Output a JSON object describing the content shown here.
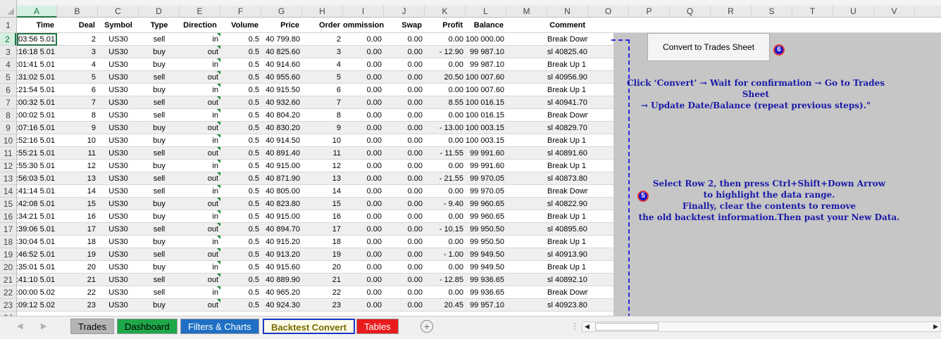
{
  "columns": [
    {
      "letter": "A",
      "header": "Time"
    },
    {
      "letter": "B",
      "header": "Deal"
    },
    {
      "letter": "C",
      "header": "Symbol"
    },
    {
      "letter": "D",
      "header": "Type"
    },
    {
      "letter": "E",
      "header": "Direction"
    },
    {
      "letter": "F",
      "header": "Volume"
    },
    {
      "letter": "G",
      "header": "Price"
    },
    {
      "letter": "H",
      "header": "Order"
    },
    {
      "letter": "I",
      "header": "ommission"
    },
    {
      "letter": "J",
      "header": "Swap"
    },
    {
      "letter": "K",
      "header": "Profit"
    },
    {
      "letter": "L",
      "header": "Balance"
    },
    {
      "letter": "M",
      "header": ""
    },
    {
      "letter": "N",
      "header": "Comment"
    },
    {
      "letter": "O",
      "header": ""
    },
    {
      "letter": "P",
      "header": ""
    },
    {
      "letter": "Q",
      "header": ""
    },
    {
      "letter": "R",
      "header": ""
    },
    {
      "letter": "S",
      "header": ""
    },
    {
      "letter": "T",
      "header": ""
    },
    {
      "letter": "U",
      "header": ""
    },
    {
      "letter": "V",
      "header": ""
    }
  ],
  "row_numbers": [
    "1",
    "2",
    "3",
    "4",
    "5",
    "6",
    "7",
    "8",
    "9",
    "10",
    "11",
    "12",
    "13",
    "14",
    "15",
    "16",
    "17",
    "18",
    "19",
    "20",
    "21",
    "22",
    "23",
    "24"
  ],
  "rows": [
    [
      "5.01 11:03:56",
      "2",
      "US30",
      "sell",
      "in",
      "0.5",
      "40 799.80",
      "2",
      "0.00",
      "0.00",
      "0.00",
      "100 000.00",
      "",
      "Break Down 1"
    ],
    [
      "5.01 11:16:18",
      "3",
      "US30",
      "buy",
      "out",
      "0.5",
      "40 825.60",
      "3",
      "0.00",
      "0.00",
      "- 12.90",
      "99 987.10",
      "",
      "sl 40825.40"
    ],
    [
      "5.01 12:01:41",
      "4",
      "US30",
      "buy",
      "in",
      "0.5",
      "40 914.60",
      "4",
      "0.00",
      "0.00",
      "0.00",
      "99 987.10",
      "",
      "Break Up 1"
    ],
    [
      "5.01 13:31:02",
      "5",
      "US30",
      "sell",
      "out",
      "0.5",
      "40 955.60",
      "5",
      "0.00",
      "0.00",
      "20.50",
      "100 007.60",
      "",
      "sl 40956.90"
    ],
    [
      "5.01 14:21:54",
      "6",
      "US30",
      "buy",
      "in",
      "0.5",
      "40 915.50",
      "6",
      "0.00",
      "0.00",
      "0.00",
      "100 007.60",
      "",
      "Break Up 1"
    ],
    [
      "5.01 15:00:32",
      "7",
      "US30",
      "sell",
      "out",
      "0.5",
      "40 932.60",
      "7",
      "0.00",
      "0.00",
      "8.55",
      "100 016.15",
      "",
      "sl 40941.70"
    ],
    [
      "5.01 16:00:02",
      "8",
      "US30",
      "sell",
      "in",
      "0.5",
      "40 804.20",
      "8",
      "0.00",
      "0.00",
      "0.00",
      "100 016.15",
      "",
      "Break Down 1"
    ],
    [
      "5.01 16:07:16",
      "9",
      "US30",
      "buy",
      "out",
      "0.5",
      "40 830.20",
      "9",
      "0.00",
      "0.00",
      "- 13.00",
      "100 003.15",
      "",
      "sl 40829.70"
    ],
    [
      "5.01 16:52:16",
      "10",
      "US30",
      "buy",
      "in",
      "0.5",
      "40 914.50",
      "10",
      "0.00",
      "0.00",
      "0.00",
      "100 003.15",
      "",
      "Break Up 1"
    ],
    [
      "5.01 16:55:21",
      "11",
      "US30",
      "sell",
      "out",
      "0.5",
      "40 891.40",
      "11",
      "0.00",
      "0.00",
      "- 11.55",
      "99 991.60",
      "",
      "sl 40891.60"
    ],
    [
      "5.01 18:55:30",
      "12",
      "US30",
      "buy",
      "in",
      "0.5",
      "40 915.00",
      "12",
      "0.00",
      "0.00",
      "0.00",
      "99 991.60",
      "",
      "Break Up 1"
    ],
    [
      "5.01 18:56:03",
      "13",
      "US30",
      "sell",
      "out",
      "0.5",
      "40 871.90",
      "13",
      "0.00",
      "0.00",
      "- 21.55",
      "99 970.05",
      "",
      "sl 40873.80"
    ],
    [
      "5.01 19:41:14",
      "14",
      "US30",
      "sell",
      "in",
      "0.5",
      "40 805.00",
      "14",
      "0.00",
      "0.00",
      "0.00",
      "99 970.05",
      "",
      "Break Down 1"
    ],
    [
      "5.01 19:42:08",
      "15",
      "US30",
      "buy",
      "out",
      "0.5",
      "40 823.80",
      "15",
      "0.00",
      "0.00",
      "- 9.40",
      "99 960.65",
      "",
      "sl 40822.90"
    ],
    [
      "5.01 20:34:21",
      "16",
      "US30",
      "buy",
      "in",
      "0.5",
      "40 915.00",
      "16",
      "0.00",
      "0.00",
      "0.00",
      "99 960.65",
      "",
      "Break Up 1"
    ],
    [
      "5.01 20:39:06",
      "17",
      "US30",
      "sell",
      "out",
      "0.5",
      "40 894.70",
      "17",
      "0.00",
      "0.00",
      "- 10.15",
      "99 950.50",
      "",
      "sl 40895.60"
    ],
    [
      "5.01 21:30:04",
      "18",
      "US30",
      "buy",
      "in",
      "0.5",
      "40 915.20",
      "18",
      "0.00",
      "0.00",
      "0.00",
      "99 950.50",
      "",
      "Break Up 1"
    ],
    [
      "5.01 21:46:52",
      "19",
      "US30",
      "sell",
      "out",
      "0.5",
      "40 913.20",
      "19",
      "0.00",
      "0.00",
      "- 1.00",
      "99 949.50",
      "",
      "sl 40913.90"
    ],
    [
      "5.01 22:35:01",
      "20",
      "US30",
      "buy",
      "in",
      "0.5",
      "40 915.60",
      "20",
      "0.00",
      "0.00",
      "0.00",
      "99 949.50",
      "",
      "Break Up 1"
    ],
    [
      "5.01 22:41:10",
      "21",
      "US30",
      "sell",
      "out",
      "0.5",
      "40 889.90",
      "21",
      "0.00",
      "0.00",
      "- 12.85",
      "99 936.65",
      "",
      "sl 40892.10"
    ],
    [
      "5.02 11:00:00",
      "22",
      "US30",
      "sell",
      "in",
      "0.5",
      "40 965.20",
      "22",
      "0.00",
      "0.00",
      "0.00",
      "99 936.65",
      "",
      "Break Down 1"
    ],
    [
      "5.02 11:09:12",
      "23",
      "US30",
      "buy",
      "out",
      "0.5",
      "40 924.30",
      "23",
      "0.00",
      "0.00",
      "20.45",
      "99 957.10",
      "",
      "sl 40923.80"
    ]
  ],
  "convert_button": "Convert to Trades Sheet",
  "badge_6": "6",
  "badge_5": "5",
  "note_convert": [
    "Click ‘Convert’ → Wait for confirmation → Go to Trades Sheet",
    "→ Update Date/Balance (repeat previous steps).\""
  ],
  "note_select": [
    "Select Row 2, then press Ctrl+Shift+Down Arrow",
    "to highlight the data range.",
    "Finally, clear the contents to remove",
    "the old backtest information.Then past your New Data."
  ],
  "tabs": [
    {
      "label": "Trades",
      "color": "#b5b5b5",
      "text": "#000000"
    },
    {
      "label": "Dashboard",
      "color": "#1fa84a",
      "text": "#000000"
    },
    {
      "label": "Filters & Charts",
      "color": "#1f6fc4",
      "text": "#ffffff"
    },
    {
      "label": "Backtest Convert",
      "color": "#fbfbe8",
      "text": "#7a6a00"
    },
    {
      "label": "Tables",
      "color": "#e81c1c",
      "text": "#ffffff"
    }
  ],
  "active_tab": 3,
  "colors": {
    "selection": "#217346",
    "annotation_blue": "#1a1aa8",
    "dashed": "#2a2ae0"
  }
}
